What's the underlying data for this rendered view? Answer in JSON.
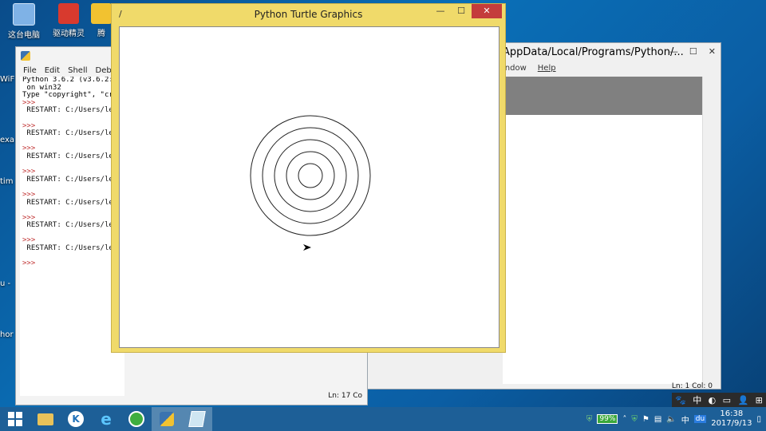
{
  "desktop": {
    "icons": [
      {
        "label": "这台电脑"
      },
      {
        "label": "驱动精灵"
      },
      {
        "label": "腾"
      }
    ],
    "edge_labels": [
      "WiF",
      "exa",
      "tim",
      "u -",
      "hor"
    ]
  },
  "shell_window": {
    "menu": [
      "File",
      "Edit",
      "Shell",
      "Debug"
    ],
    "lines": [
      {
        "text": "Python 3.6.2 (v3.6.2:",
        "kind": "output"
      },
      {
        "text": " on win32",
        "kind": "output"
      },
      {
        "text": "Type \"copyright\", \"cr",
        "kind": "output"
      },
      {
        "text": ">>>",
        "kind": "prompt"
      },
      {
        "text": " RESTART: C:/Users/le",
        "kind": "restart"
      },
      {
        "text": "",
        "kind": "blank"
      },
      {
        "text": ">>>",
        "kind": "prompt"
      },
      {
        "text": " RESTART: C:/Users/le",
        "kind": "restart"
      },
      {
        "text": "",
        "kind": "blank"
      },
      {
        "text": ">>>",
        "kind": "prompt"
      },
      {
        "text": " RESTART: C:/Users/le",
        "kind": "restart"
      },
      {
        "text": "",
        "kind": "blank"
      },
      {
        "text": ">>>",
        "kind": "prompt"
      },
      {
        "text": " RESTART: C:/Users/le",
        "kind": "restart"
      },
      {
        "text": "",
        "kind": "blank"
      },
      {
        "text": ">>>",
        "kind": "prompt"
      },
      {
        "text": " RESTART: C:/Users/le",
        "kind": "restart"
      },
      {
        "text": "",
        "kind": "blank"
      },
      {
        "text": ">>>",
        "kind": "prompt"
      },
      {
        "text": " RESTART: C:/Users/le",
        "kind": "restart"
      },
      {
        "text": "",
        "kind": "blank"
      },
      {
        "text": ">>>",
        "kind": "prompt"
      },
      {
        "text": " RESTART: C:/Users/le",
        "kind": "restart"
      },
      {
        "text": "",
        "kind": "blank"
      },
      {
        "text": ">>>",
        "kind": "prompt"
      }
    ],
    "status": "Ln: 17  Co"
  },
  "editor_window": {
    "title": "AppData/Local/Programs/Python/...",
    "menu": [
      "indow",
      "Help"
    ],
    "status": "Ln: 1  Col: 0"
  },
  "turtle_window": {
    "title": "Python Turtle Graphics",
    "min_glyph": "—",
    "max_glyph": "☐",
    "close_glyph": "✕",
    "circle_count": 5
  },
  "taskbar": {
    "battery": "99%",
    "ime": "中",
    "clock_time": "16:38",
    "clock_date": "2017/9/13"
  },
  "ime_bar": {
    "lang": "中"
  }
}
